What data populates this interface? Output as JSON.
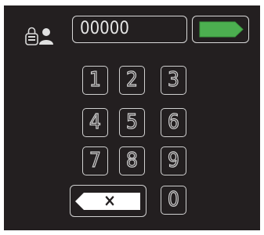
{
  "keypad": {
    "code_value": "00000",
    "keys": [
      "1",
      "2",
      "3",
      "4",
      "5",
      "6",
      "7",
      "8",
      "9",
      "0"
    ],
    "backspace_label": "×"
  },
  "icons": {
    "user": "lock-user-icon",
    "enter": "enter-arrow-icon",
    "backspace": "backspace-icon"
  },
  "colors": {
    "background": "#231f20",
    "outline": "#d0d0d0",
    "enter_green": "#4caf50"
  }
}
